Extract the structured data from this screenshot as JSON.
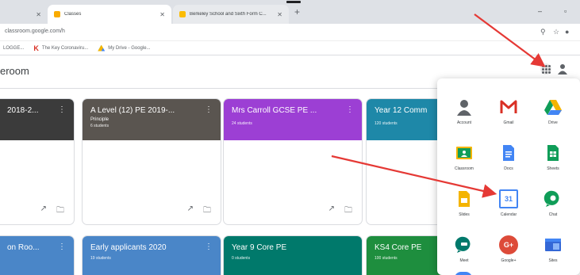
{
  "browser": {
    "tabs": [
      {
        "title": "",
        "active": false
      },
      {
        "title": "Classes",
        "active": true,
        "favicon_color": "#f9ab00"
      },
      {
        "title": "Berkeley School and Sixth Form C...",
        "active": false,
        "favicon_color": "#fbbc04"
      }
    ],
    "new_tab": "+",
    "window_controls": {
      "minimize": "–",
      "maximize": "▫"
    },
    "url": "classroom.google.com/h",
    "bookmarks": [
      {
        "label": "LOGGE...",
        "icon": "dot-icon"
      },
      {
        "label": "The Key Coronaviru...",
        "icon": "k-icon"
      },
      {
        "label": "My Drive - Google...",
        "icon": "drive-icon"
      }
    ]
  },
  "header": {
    "app_name": "eroom"
  },
  "cards": [
    {
      "title": "2018-2...",
      "subtitle": "",
      "students": "",
      "color": "#3b3b3b"
    },
    {
      "title": "A Level (12) PE 2019-...",
      "subtitle": "Principle",
      "students": "6 students",
      "color": "#5a5550"
    },
    {
      "title": "Mrs Carroll GCSE PE ...",
      "subtitle": "",
      "students": "24 students",
      "color": "#9c3fd4"
    },
    {
      "title": "Year 12 Comm",
      "subtitle": "",
      "students": "120 students",
      "color": "#1e88a8"
    },
    {
      "title": "on Roo...",
      "subtitle": "",
      "students": "",
      "color": "#4a86c8"
    },
    {
      "title": "Early applicants 2020",
      "subtitle": "",
      "students": "19 students",
      "color": "#4a86c8"
    },
    {
      "title": "Year 9 Core PE",
      "subtitle": "",
      "students": "0 students",
      "color": "#00796b"
    },
    {
      "title": "KS4 Core PE",
      "subtitle": "",
      "students": "100 students",
      "color": "#1e8e3e"
    }
  ],
  "card_actions": {
    "trend": "↗",
    "folder": "🗀",
    "menu": "⋮"
  },
  "launcher": {
    "apps": [
      {
        "label": "Account",
        "icon": "account-icon"
      },
      {
        "label": "Gmail",
        "icon": "gmail-icon"
      },
      {
        "label": "Drive",
        "icon": "drive-icon"
      },
      {
        "label": "Classroom",
        "icon": "classroom-icon"
      },
      {
        "label": "Docs",
        "icon": "docs-icon"
      },
      {
        "label": "Sheets",
        "icon": "sheets-icon"
      },
      {
        "label": "Slides",
        "icon": "slides-icon"
      },
      {
        "label": "Calendar",
        "icon": "calendar-icon",
        "number": "31"
      },
      {
        "label": "Chat",
        "icon": "chat-icon"
      },
      {
        "label": "Meet",
        "icon": "meet-icon"
      },
      {
        "label": "Google+",
        "icon": "google-plus-icon",
        "glyph": "G+"
      },
      {
        "label": "Sites",
        "icon": "sites-icon"
      }
    ]
  },
  "colors": {
    "arrow": "#e53935",
    "gmail": "#d93025",
    "docs": "#4285f4",
    "sheets": "#0f9d58",
    "slides": "#f4b400"
  }
}
